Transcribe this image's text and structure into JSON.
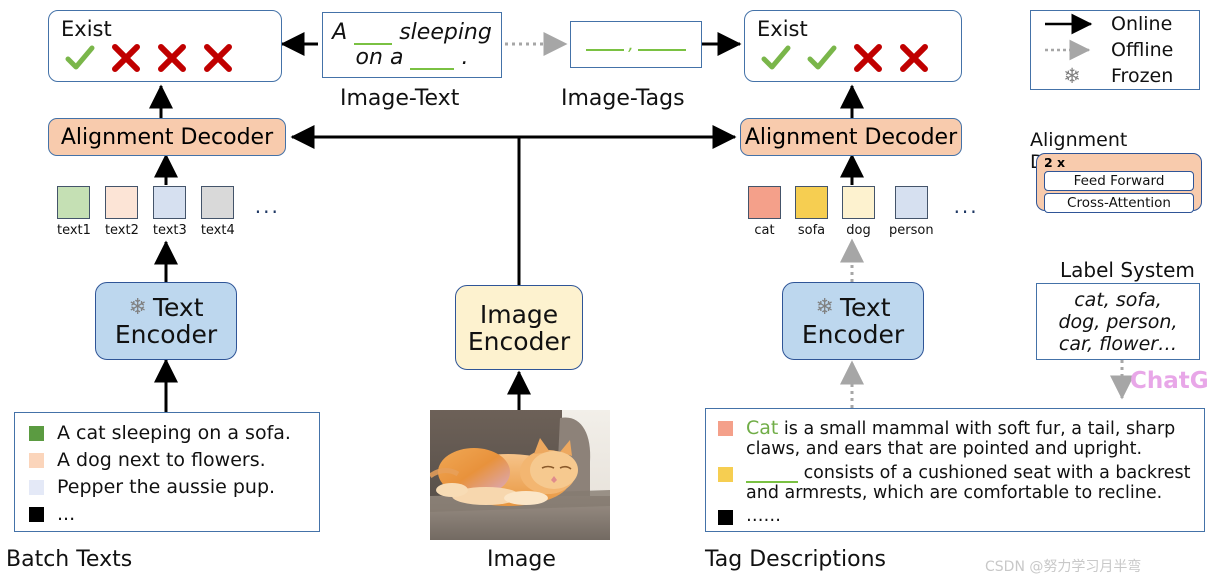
{
  "left_exist": {
    "title": "Exist",
    "marks": [
      "check",
      "cross",
      "cross",
      "cross"
    ]
  },
  "right_exist": {
    "title": "Exist",
    "marks": [
      "check",
      "check",
      "cross",
      "cross"
    ]
  },
  "image_text": {
    "line1_a": "A",
    "line1_b": "sleeping",
    "line2_a": "on a",
    "line2_b": ".",
    "caption": "Image-Text"
  },
  "image_tags": {
    "caption": "Image-Tags",
    "separator": ","
  },
  "decoders": {
    "left_label": "Alignment Decoder",
    "right_label": "Alignment Decoder"
  },
  "text_embeddings": {
    "items": [
      {
        "label": "text1",
        "color": "#c5e0b4"
      },
      {
        "label": "text2",
        "color": "#fce4d6"
      },
      {
        "label": "text3",
        "color": "#d6e0f0"
      },
      {
        "label": "text4",
        "color": "#d9d9d9"
      }
    ],
    "ellipsis": "..."
  },
  "tag_embeddings": {
    "items": [
      {
        "label": "cat",
        "color": "#f4a08a"
      },
      {
        "label": "sofa",
        "color": "#f6ce51"
      },
      {
        "label": "dog",
        "color": "#fdf2cf"
      },
      {
        "label": "person",
        "color": "#d6e0f0"
      }
    ],
    "ellipsis": "..."
  },
  "encoders": {
    "left_text_encoder": {
      "line1": "Text",
      "line2": "Encoder",
      "frozen": true
    },
    "image_encoder": {
      "line1": "Image",
      "line2": "Encoder",
      "frozen": false
    },
    "right_text_encoder": {
      "line1": "Text",
      "line2": "Encoder",
      "frozen": true
    }
  },
  "batch_texts": {
    "caption": "Batch Texts",
    "items": [
      {
        "color": "#5b9b41",
        "text": "A cat sleeping on a sofa."
      },
      {
        "color": "#fbd5bb",
        "text": "A dog next to flowers."
      },
      {
        "color": "#e4e9f7",
        "text": "Pepper the aussie pup."
      },
      {
        "color": "#000000",
        "text": "..."
      }
    ]
  },
  "image_panel": {
    "caption": "Image",
    "alt": "orange cat sleeping on a sofa"
  },
  "tag_descriptions": {
    "caption": "Tag Descriptions",
    "items": [
      {
        "color": "#f4a08a",
        "head": "Cat",
        "head_color": "#70ad47",
        "body": " is a small mammal with soft fur, a tail, sharp claws, and ears that are pointed and upright."
      },
      {
        "color": "#f6ce51",
        "head": "",
        "blank": true,
        "body": " consists of a cushioned seat with a backrest and armrests, which are comfortable to recline."
      },
      {
        "color": "#000000",
        "head": "",
        "body": "……"
      }
    ]
  },
  "legend": {
    "items": [
      {
        "label": "Online",
        "kind": "solid-arrow",
        "color": "#000000"
      },
      {
        "label": "Offline",
        "kind": "dotted-arrow",
        "color": "#a6a6a6"
      },
      {
        "label": "Frozen",
        "kind": "snowflake",
        "color": "#808080"
      }
    ]
  },
  "alignment_decoder_detail": {
    "title": "Alignment Decoder",
    "repeat": "2 x",
    "layers": [
      "Feed Forward",
      "Cross-Attention"
    ]
  },
  "label_system": {
    "title": "Label System",
    "line1": "cat, sofa,",
    "line2": "dog, person,",
    "line3": "car, flower…"
  },
  "chatgpt": {
    "label": "ChatGPT",
    "color": "#e8a7e8"
  },
  "watermark": {
    "text": "CSDN @努力学习月半弯"
  }
}
